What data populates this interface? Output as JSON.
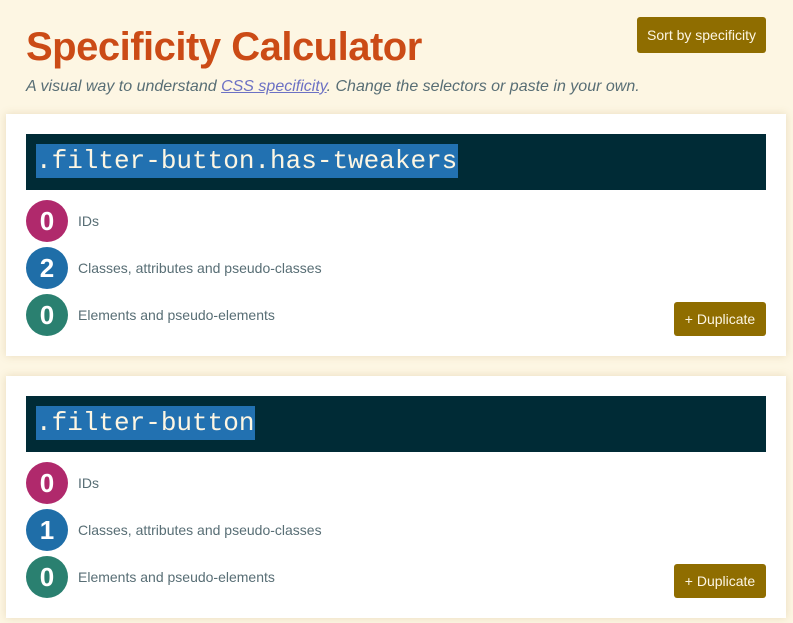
{
  "header": {
    "title": "Specificity Calculator",
    "subtitle_prefix": "A visual way to understand ",
    "subtitle_link": "CSS specificity",
    "subtitle_suffix": ". Change the selectors or paste in your own.",
    "sort_button": "Sort by specificity"
  },
  "labels": {
    "ids": "IDs",
    "classes": "Classes, attributes and pseudo-classes",
    "elements": "Elements and pseudo-elements",
    "duplicate": "+ Duplicate"
  },
  "cards": [
    {
      "selector": ".filter-button.has-tweakers",
      "ids": "0",
      "classes": "2",
      "elements": "0"
    },
    {
      "selector": ".filter-button",
      "ids": "0",
      "classes": "1",
      "elements": "0"
    }
  ],
  "colors": {
    "background": "#fdf6e3",
    "title": "#cb4b16",
    "button": "#8f6d00",
    "selector_bg": "#002b36",
    "selector_highlight": "#2271b1",
    "ids_badge": "#b0296c",
    "classes_badge": "#1f6ea8",
    "elements_badge": "#2a8070"
  }
}
